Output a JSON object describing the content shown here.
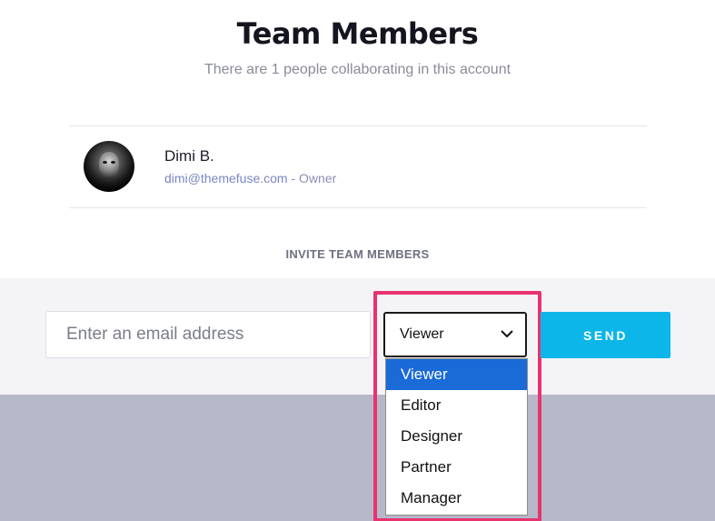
{
  "header": {
    "title": "Team Members",
    "subtitle": "There are 1 people collaborating in this account"
  },
  "members": [
    {
      "name": "Dimi B.",
      "email": "dimi@themefuse.com",
      "role_suffix": " - Owner"
    }
  ],
  "invite": {
    "label": "INVITE TEAM MEMBERS",
    "email_placeholder": "Enter an email address",
    "email_value": "",
    "role_selected": "Viewer",
    "role_options": [
      "Viewer",
      "Editor",
      "Designer",
      "Partner",
      "Manager"
    ],
    "send_label": "SEND"
  },
  "colors": {
    "accent": "#0db6e8",
    "highlight": "#e8336f",
    "selected_option": "#1a6ad8"
  },
  "icons": {
    "select_arrow": "chevron-down-icon"
  }
}
